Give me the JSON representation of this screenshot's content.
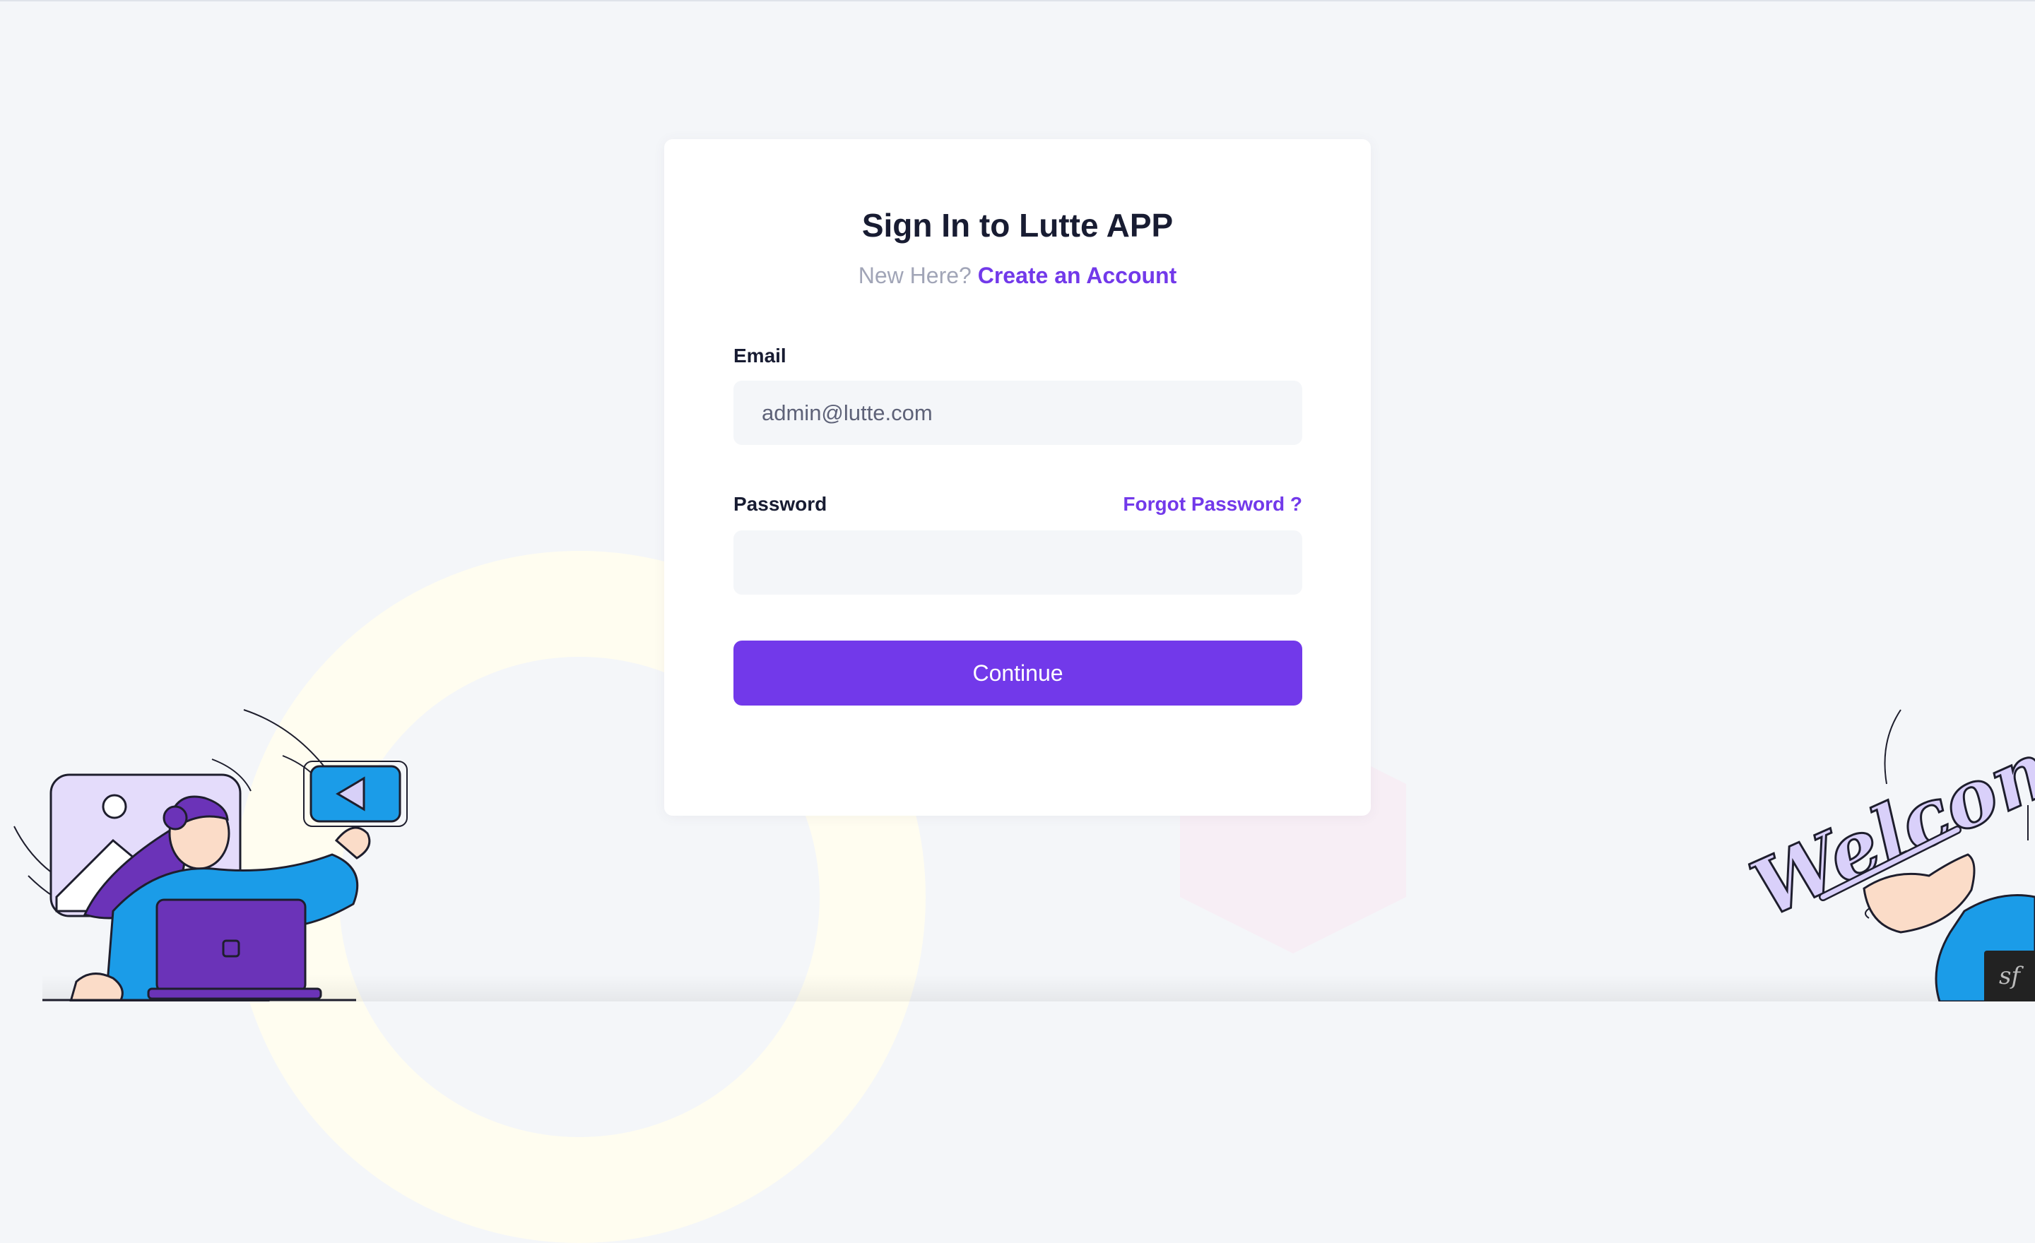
{
  "signin": {
    "title": "Sign In to Lutte APP",
    "new_here": "New Here?",
    "create_account": "Create an Account",
    "email_label": "Email",
    "email_value": "admin@lutte.com",
    "password_label": "Password",
    "forgot_password": "Forgot Password ?",
    "password_value": "",
    "continue_label": "Continue"
  },
  "illustrations": {
    "left": "person-laptop-illustration",
    "right": "welcome-hand-illustration",
    "right_text": "Welcome"
  },
  "toolbar": {
    "symfony_icon": "symfony-icon",
    "symfony_glyph": "sf"
  },
  "colors": {
    "primary": "#7239ea",
    "background": "#f4f6f9",
    "card": "#ffffff",
    "title": "#181c32",
    "muted": "#a1a5b7"
  }
}
